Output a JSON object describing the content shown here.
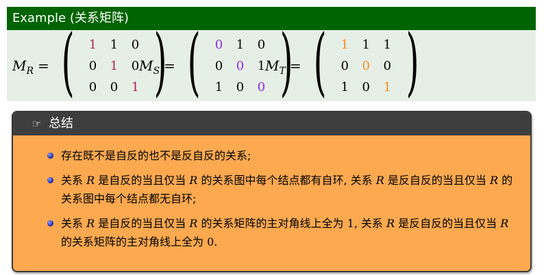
{
  "example": {
    "title": "Example (关系矩阵)",
    "matrices": [
      {
        "symbol": "M",
        "subscript": "R",
        "eq": "=",
        "rows": [
          [
            "1",
            "1",
            "0"
          ],
          [
            "0",
            "1",
            "0"
          ],
          [
            "0",
            "0",
            "1"
          ]
        ],
        "highlight_color": "#b0205a"
      },
      {
        "symbol": "M",
        "subscript": "S",
        "eq": "=",
        "rows": [
          [
            "0",
            "1",
            "0"
          ],
          [
            "0",
            "0",
            "1"
          ],
          [
            "1",
            "0",
            "0"
          ]
        ],
        "highlight_color": "#8a2be2"
      },
      {
        "symbol": "M",
        "subscript": "T",
        "eq": "=",
        "rows": [
          [
            "1",
            "1",
            "1"
          ],
          [
            "0",
            "0",
            "0"
          ],
          [
            "1",
            "0",
            "1"
          ]
        ],
        "highlight_color": "#f39020"
      }
    ]
  },
  "summary": {
    "icon": "pointing-hand-icon",
    "icon_glyph": "☞",
    "title": "总结",
    "items": [
      {
        "parts": [
          "存在既不是自反的也不是反自反的关系;"
        ]
      },
      {
        "parts": [
          "关系 ",
          "R",
          " 是自反的当且仅当 ",
          "R",
          " 的关系图中每个结点都有自环, 关系 ",
          "R",
          " 是反自反的当且仅当 ",
          "R",
          " 的关系图中每个结点都无自环;"
        ]
      },
      {
        "parts": [
          "关系 ",
          "R",
          " 是自反的当且仅当 ",
          "R",
          " 的关系矩阵的主对角线上全为 ",
          "1",
          ", 关系 ",
          "R",
          " 是反自反的当且仅当 ",
          "R",
          " 的关系矩阵的主对角线上全为 ",
          "0",
          "."
        ]
      }
    ]
  },
  "colors": {
    "example_header_bg": "#006400",
    "example_body_bg": "#e6efe6",
    "summary_header_bg": "#3e3e3e",
    "summary_body_bg": "#fca950",
    "bullet": "#2b35b0"
  }
}
